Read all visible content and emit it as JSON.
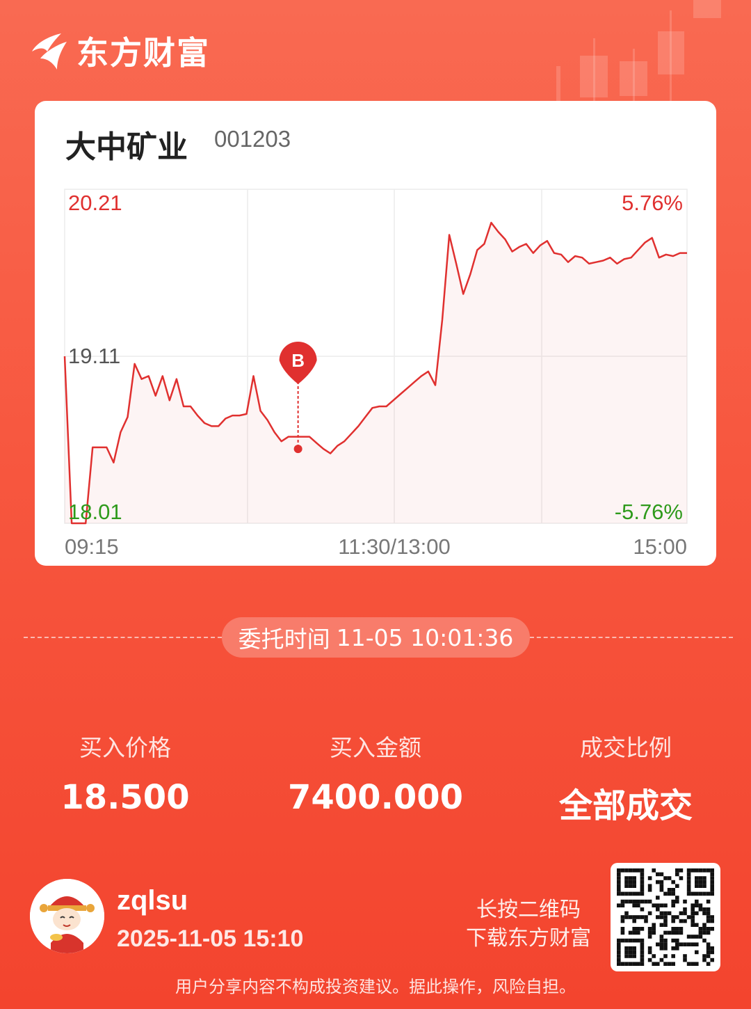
{
  "brand": {
    "name": "东方财富"
  },
  "stock": {
    "name": "大中矿业",
    "code": "001203"
  },
  "chart_data": {
    "type": "line",
    "x_ticks": [
      "09:15",
      "11:30/13:00",
      "15:00"
    ],
    "y_left_ticks": [
      "20.21",
      "19.11",
      "18.01"
    ],
    "y_right_ticks": [
      "5.76%",
      "-5.76%"
    ],
    "ylim": [
      18.01,
      20.21
    ],
    "reference_price": 19.11,
    "marker": {
      "label": "B",
      "price": 18.5,
      "position_fraction": 0.375
    },
    "series": [
      {
        "values": [
          19.11,
          18.01,
          18.01,
          18.01,
          18.51,
          18.51,
          18.51,
          18.41,
          18.61,
          18.71,
          19.06,
          18.96,
          18.98,
          18.85,
          18.98,
          18.82,
          18.96,
          18.78,
          18.78,
          18.72,
          18.67,
          18.65,
          18.65,
          18.7,
          18.72,
          18.72,
          18.73,
          18.98,
          18.75,
          18.69,
          18.61,
          18.55,
          18.58,
          18.58,
          18.58,
          18.58,
          18.54,
          18.5,
          18.47,
          18.52,
          18.55,
          18.6,
          18.65,
          18.71,
          18.77,
          18.78,
          18.78,
          18.82,
          18.86,
          18.9,
          18.94,
          18.98,
          19.01,
          18.92,
          19.35,
          19.91,
          19.72,
          19.52,
          19.65,
          19.81,
          19.85,
          19.99,
          19.93,
          19.88,
          19.8,
          19.83,
          19.85,
          19.79,
          19.84,
          19.87,
          19.79,
          19.78,
          19.73,
          19.77,
          19.76,
          19.72,
          19.73,
          19.74,
          19.76,
          19.72,
          19.75,
          19.76,
          19.81,
          19.86,
          19.89,
          19.76,
          19.78,
          19.77,
          19.79,
          19.79
        ]
      }
    ]
  },
  "order": {
    "label": "委托时间",
    "time": "11-05 10:01:36"
  },
  "stats": [
    {
      "label": "买入价格",
      "value": "18.500"
    },
    {
      "label": "买入金额",
      "value": "7400.000"
    },
    {
      "label": "成交比例",
      "value": "全部成交"
    }
  ],
  "user": {
    "name": "zqlsu",
    "time": "2025-11-05 15:10"
  },
  "qr": {
    "hint1": "长按二维码",
    "hint2": "下载东方财富"
  },
  "disclaimer": "用户分享内容不构成投资建议。据此操作，风险自担。",
  "colors": {
    "up": "#e0302f",
    "down": "#2e9a1b",
    "neutral": "#666666"
  }
}
